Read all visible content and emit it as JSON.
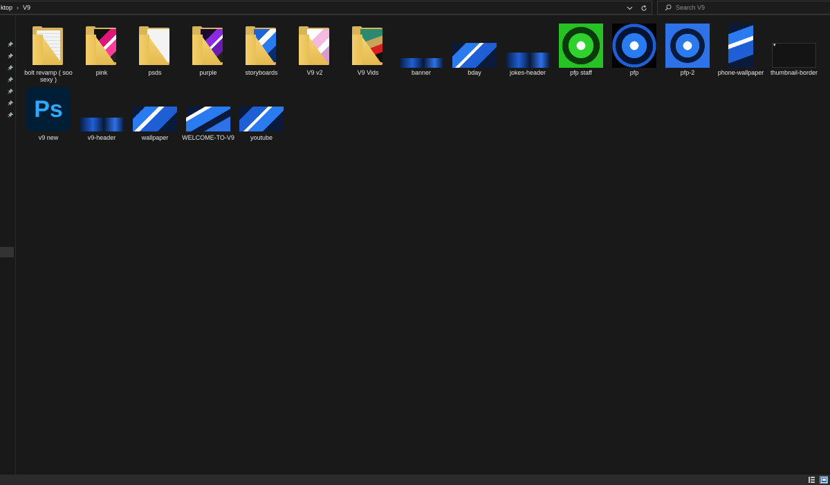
{
  "address": {
    "crumbs": [
      "ktop",
      "V9"
    ],
    "separator": "›"
  },
  "search": {
    "placeholder": "Search V9"
  },
  "items_row1": [
    {
      "name": "bolt revamp ( soo sexy )",
      "kind": "folder",
      "preview": "documents"
    },
    {
      "name": "pink",
      "kind": "folder",
      "preview": "pink"
    },
    {
      "name": "psds",
      "kind": "folder",
      "preview": "blank"
    },
    {
      "name": "purple",
      "kind": "folder",
      "preview": "purple"
    },
    {
      "name": "storyboards",
      "kind": "folder",
      "preview": "blue"
    },
    {
      "name": "V9 v2",
      "kind": "folder",
      "preview": "pinkwhite"
    },
    {
      "name": "V9 Vids",
      "kind": "folder",
      "preview": "game"
    },
    {
      "name": "banner",
      "kind": "image",
      "preview": "banner"
    },
    {
      "name": "bday",
      "kind": "image",
      "preview": "bday"
    },
    {
      "name": "jokes-header",
      "kind": "image",
      "preview": "banner-small"
    },
    {
      "name": "pfp staff",
      "kind": "image",
      "preview": "green"
    },
    {
      "name": "pfp",
      "kind": "image",
      "preview": "dark-blue"
    },
    {
      "name": "pfp-2",
      "kind": "image",
      "preview": "blue-square"
    },
    {
      "name": "phone-wallpaper",
      "kind": "image",
      "preview": "tall-blue"
    },
    {
      "name": "thumbnail-border",
      "kind": "image",
      "preview": "empty"
    }
  ],
  "items_row2": [
    {
      "name": "v9 new",
      "kind": "psd",
      "preview": "ps"
    },
    {
      "name": "v9-header",
      "kind": "image",
      "preview": "banner"
    },
    {
      "name": "wallpaper",
      "kind": "image",
      "preview": "wide"
    },
    {
      "name": "WELCOME-TO-V9",
      "kind": "image",
      "preview": "wide"
    },
    {
      "name": "youtube",
      "kind": "image",
      "preview": "wide"
    }
  ],
  "ps_icon_text": "Ps",
  "colors": {
    "background": "#191919",
    "folder": "#e4b94f",
    "ps_blue": "#31a8ff",
    "ps_bg": "#001e36"
  }
}
